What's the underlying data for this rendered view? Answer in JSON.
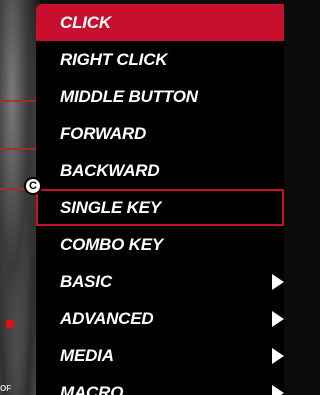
{
  "background_caption": "OF",
  "callout": {
    "label": "C"
  },
  "menu": {
    "items": [
      {
        "label": "CLICK",
        "state": "active",
        "submenu": false
      },
      {
        "label": "RIGHT CLICK",
        "state": "normal",
        "submenu": false
      },
      {
        "label": "MIDDLE BUTTON",
        "state": "normal",
        "submenu": false
      },
      {
        "label": "FORWARD",
        "state": "normal",
        "submenu": false
      },
      {
        "label": "BACKWARD",
        "state": "normal",
        "submenu": false
      },
      {
        "label": "SINGLE KEY",
        "state": "outlined",
        "submenu": false
      },
      {
        "label": "COMBO KEY",
        "state": "normal",
        "submenu": false
      },
      {
        "label": "BASIC",
        "state": "normal",
        "submenu": true
      },
      {
        "label": "ADVANCED",
        "state": "normal",
        "submenu": true
      },
      {
        "label": "MEDIA",
        "state": "normal",
        "submenu": true
      },
      {
        "label": "MACRO",
        "state": "normal",
        "submenu": true
      }
    ]
  },
  "colors": {
    "accent": "#c8102e",
    "menu_bg": "#000000",
    "text": "#ffffff"
  }
}
